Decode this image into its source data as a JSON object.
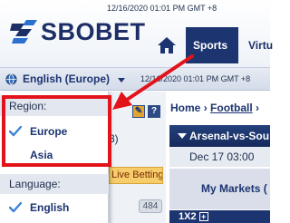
{
  "header": {
    "logo_text": "SBOBET",
    "datetime": "12/16/2020 01:01 PM GMT +8",
    "tabs": [
      {
        "label": "Sports",
        "active": true
      },
      {
        "label": "Virtu",
        "active": false
      }
    ]
  },
  "language_bar": {
    "selected_language": "English (Europe)",
    "time": "12/16/2020 01:01 PM GMT +8"
  },
  "dropdown": {
    "region_heading": "Region:",
    "regions": [
      {
        "label": "Europe",
        "checked": true
      },
      {
        "label": "Asia",
        "checked": false
      }
    ],
    "language_heading": "Language:",
    "languages": [
      {
        "label": "English",
        "checked": true
      }
    ]
  },
  "left_panel": {
    "partial_text": "3)",
    "live_betting": "Live Betting",
    "count": "484"
  },
  "main": {
    "breadcrumb_home": "Home",
    "breadcrumb_separator": "›",
    "breadcrumb_current": "Football",
    "breadcrumb_tail": "›",
    "match_title": "Arsenal-vs-Sou",
    "match_date": "Dec 17 03:00",
    "markets_label": "My Markets",
    "markets_count": "(",
    "market_row": "1X2"
  },
  "colors": {
    "brand_navy": "#1c3470",
    "highlight_red": "#e2131a",
    "check_blue": "#3b83d6",
    "live_betting_bg": "#f6cd6a"
  }
}
